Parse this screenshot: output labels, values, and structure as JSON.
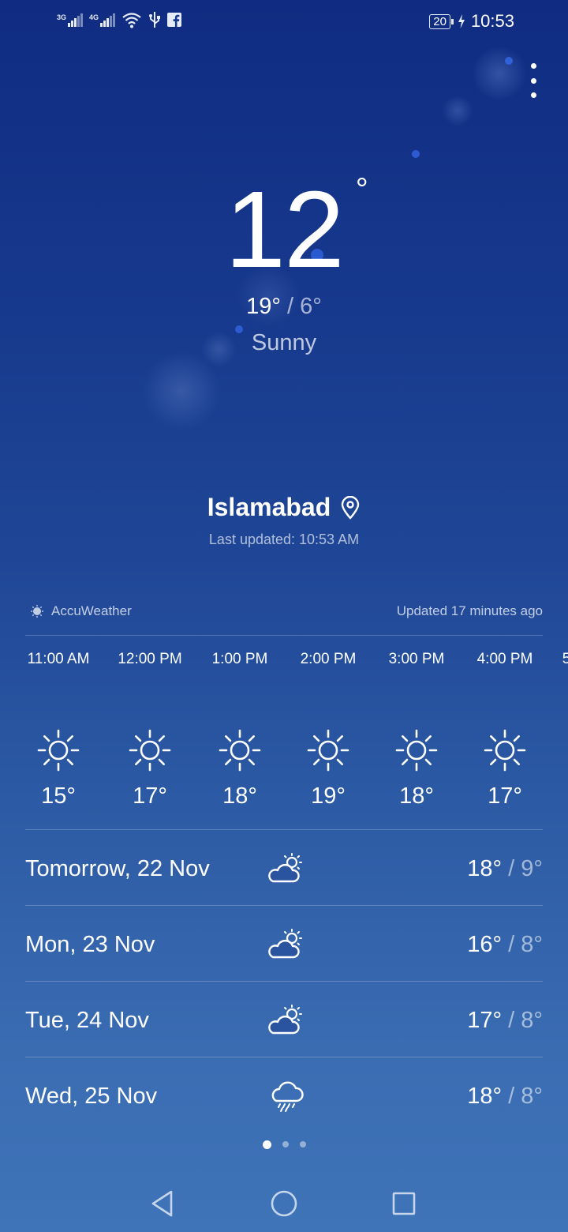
{
  "status_bar": {
    "signal_1": "3G",
    "signal_2": "4G",
    "battery": "20",
    "time": "10:53",
    "icons": [
      "signal-icon",
      "signal-icon",
      "wifi-icon",
      "usb-icon",
      "facebook-icon",
      "charging-icon"
    ]
  },
  "current": {
    "temperature": "12",
    "degree_symbol": "°",
    "high": "19°",
    "separator": " / ",
    "low": "6°",
    "condition": "Sunny"
  },
  "location": {
    "city": "Islamabad",
    "last_updated": "Last updated: 10:53 AM"
  },
  "provider": {
    "name": "AccuWeather",
    "updated": "Updated 17 minutes ago"
  },
  "hourly": [
    {
      "time": "11:00 AM",
      "temp": "15°",
      "icon": "sun-icon"
    },
    {
      "time": "12:00 PM",
      "temp": "17°",
      "icon": "sun-icon"
    },
    {
      "time": "1:00 PM",
      "temp": "18°",
      "icon": "sun-icon"
    },
    {
      "time": "2:00 PM",
      "temp": "19°",
      "icon": "sun-icon"
    },
    {
      "time": "3:00 PM",
      "temp": "18°",
      "icon": "sun-icon"
    },
    {
      "time": "4:00 PM",
      "temp": "17°",
      "icon": "sun-icon"
    },
    {
      "time": "5",
      "temp": "",
      "icon": ""
    }
  ],
  "daily": [
    {
      "day": "Tomorrow, 22 Nov",
      "high": "18°",
      "sep": " / ",
      "low": "9°",
      "icon": "partly-cloudy-icon"
    },
    {
      "day": "Mon, 23 Nov",
      "high": "16°",
      "sep": " / ",
      "low": "8°",
      "icon": "partly-cloudy-icon"
    },
    {
      "day": "Tue, 24 Nov",
      "high": "17°",
      "sep": " / ",
      "low": "8°",
      "icon": "partly-cloudy-icon"
    },
    {
      "day": "Wed, 25 Nov",
      "high": "18°",
      "sep": " / ",
      "low": "8°",
      "icon": "rain-icon"
    }
  ],
  "pager": {
    "count": 3,
    "active": 0
  },
  "colors": {
    "background_top": "#0f2c82",
    "background_bottom": "#3f74b8",
    "text": "#ffffff"
  }
}
